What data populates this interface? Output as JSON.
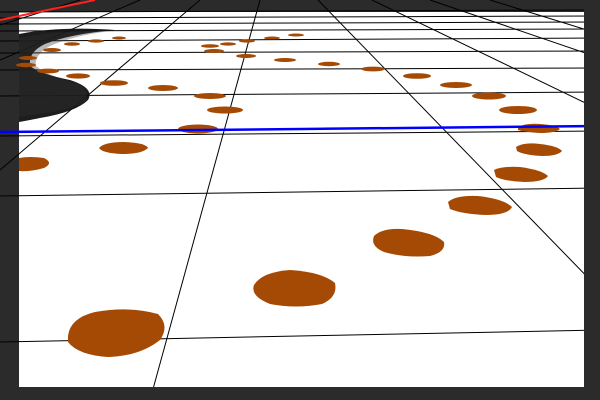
{
  "viewport": {
    "background_color": "#2b2b2b",
    "ground_color": "#ffffff",
    "grid_line_color": "#000000",
    "x_axis_color": "#ff2020",
    "y_axis_color": "#0000ff",
    "footprint_color": "#a44a04",
    "object_color": "#111111"
  },
  "scene": {
    "object": "curved-black-shadow-object",
    "trail": "footprint-trail"
  }
}
